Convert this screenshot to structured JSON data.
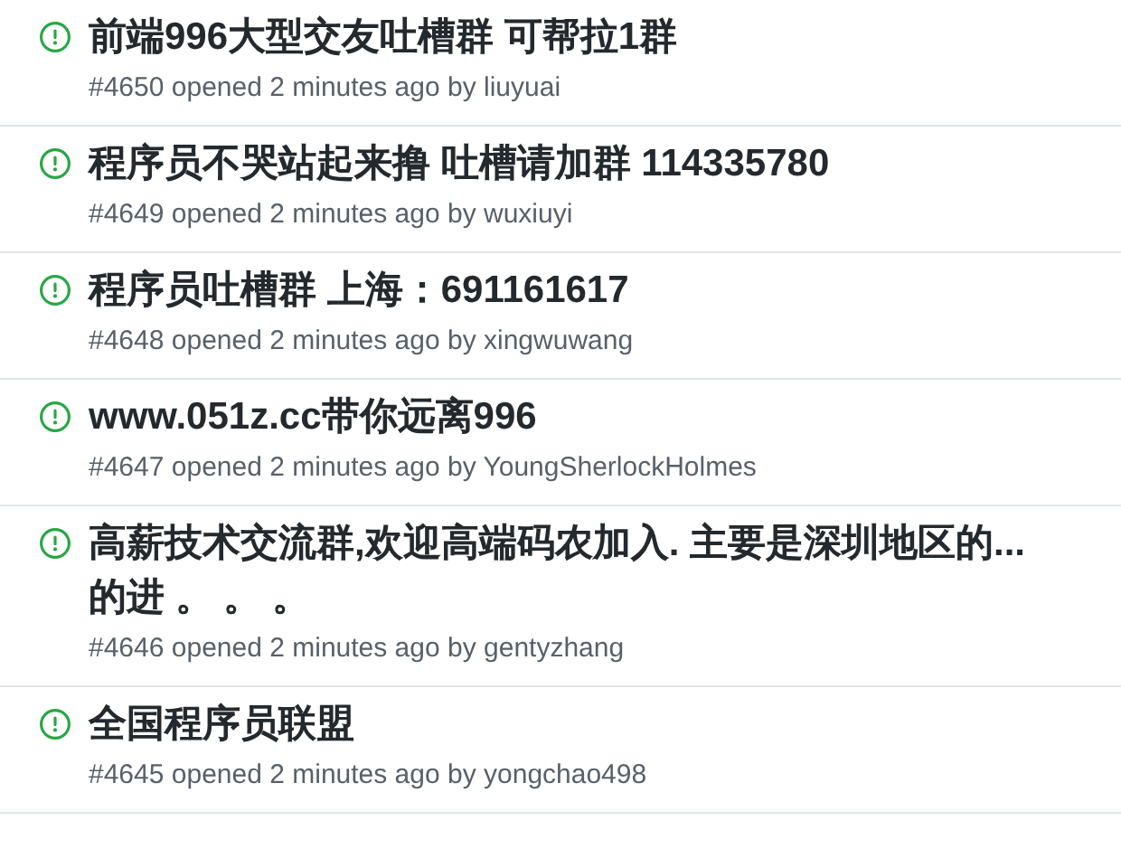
{
  "issues": [
    {
      "title_lines": [
        "前端996大型交友吐槽群 可帮拉1群"
      ],
      "meta": "#4650 opened 2 minutes ago by liuyuai"
    },
    {
      "title_lines": [
        "程序员不哭站起来撸 吐槽请加群 114335780"
      ],
      "meta": "#4649 opened 2 minutes ago by wuxiuyi"
    },
    {
      "title_lines": [
        "程序员吐槽群 上海：691161617"
      ],
      "meta": "#4648 opened 2 minutes ago by xingwuwang"
    },
    {
      "title_lines": [
        "www.051z.cc带你远离996"
      ],
      "meta": "#4647 opened 2 minutes ago by YoungSherlockHolmes"
    },
    {
      "title_lines": [
        "高薪技术交流群,欢迎高端码农加入. 主要是深圳地区的...",
        "的进 。 。 。"
      ],
      "meta": "#4646 opened 2 minutes ago by gentyzhang"
    },
    {
      "title_lines": [
        "全国程序员联盟"
      ],
      "meta": "#4645 opened 2 minutes ago by yongchao498"
    }
  ]
}
